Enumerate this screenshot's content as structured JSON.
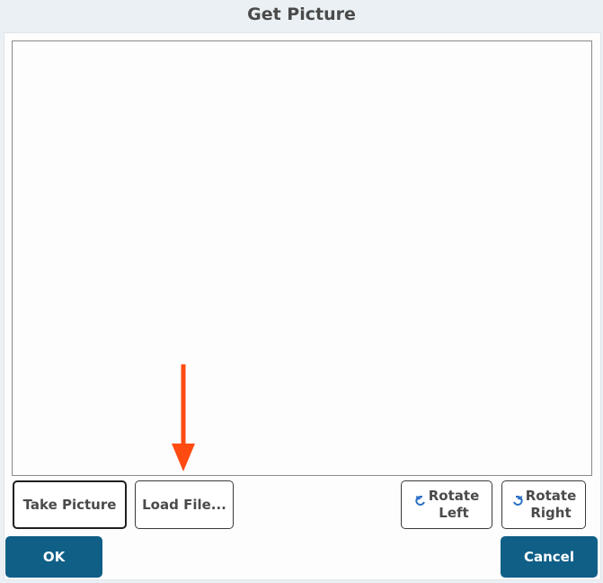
{
  "dialog": {
    "title": "Get Picture"
  },
  "toolbar": {
    "take_picture_label": "Take Picture",
    "load_file_label": "Load File...",
    "rotate_left_line1": "Rotate",
    "rotate_left_line2": "Left",
    "rotate_right_line1": "Rotate",
    "rotate_right_line2": "Right"
  },
  "footer": {
    "ok_label": "OK",
    "cancel_label": "Cancel"
  },
  "icons": {
    "rotate_left": "rotate-left-icon",
    "rotate_right": "rotate-right-icon",
    "annotation_arrow": "arrow-down-icon"
  },
  "colors": {
    "primary_button": "#0f5f87",
    "annotation_arrow": "#ff4a12",
    "rotate_icon": "#2a6fc4"
  }
}
